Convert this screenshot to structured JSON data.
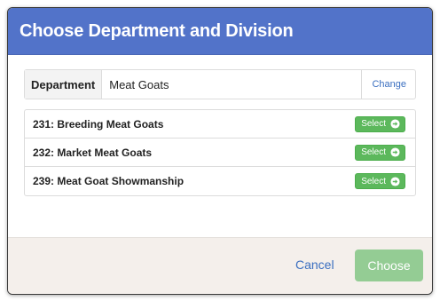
{
  "modal": {
    "title": "Choose Department and Division"
  },
  "department": {
    "label": "Department",
    "value": "Meat Goats",
    "change_label": "Change"
  },
  "divisions": [
    {
      "label": "231: Breeding Meat Goats",
      "button": "Select"
    },
    {
      "label": "232: Market Meat Goats",
      "button": "Select"
    },
    {
      "label": "239: Meat Goat Showmanship",
      "button": "Select"
    }
  ],
  "footer": {
    "cancel_label": "Cancel",
    "choose_label": "Choose",
    "choose_enabled": false
  },
  "colors": {
    "header": "#5273c9",
    "select_button": "#5cb85c",
    "choose_button_disabled": "#94cc94",
    "link": "#3b6fc0",
    "footer_bg": "#f4efeb"
  },
  "icons": {
    "select": "circle-arrow-right-icon"
  }
}
